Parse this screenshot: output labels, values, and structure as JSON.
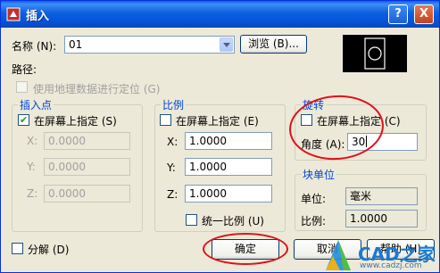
{
  "window": {
    "title": "插入",
    "help_glyph": "?",
    "close_glyph": "X"
  },
  "name_row": {
    "label": "名称 (N):",
    "value": "01",
    "browse_label": "浏览 (B)..."
  },
  "path": {
    "label": "路径:",
    "geo_checkbox_label": "使用地理数据进行定位 (G)"
  },
  "insert_point": {
    "title": "插入点",
    "on_screen_label": "在屏幕上指定 (S)",
    "on_screen_checked": true,
    "x_label": "X:",
    "y_label": "Y:",
    "z_label": "Z:",
    "x": "0.0000",
    "y": "0.0000",
    "z": "0.0000"
  },
  "scale": {
    "title": "比例",
    "on_screen_label": "在屏幕上指定 (E)",
    "on_screen_checked": false,
    "x_label": "X:",
    "y_label": "Y:",
    "z_label": "Z:",
    "x": "1.0000",
    "y": "1.0000",
    "z": "1.0000",
    "uniform_label": "统一比例 (U)"
  },
  "rotation": {
    "title": "旋转",
    "on_screen_label": "在屏幕上指定 (C)",
    "angle_label": "角度 (A):",
    "angle": "30"
  },
  "block_unit": {
    "title": "块单位",
    "unit_label": "单位:",
    "unit_value": "毫米",
    "factor_label": "比例:",
    "factor_value": "1.0000"
  },
  "explode": {
    "label": "分解 (D)"
  },
  "buttons": {
    "ok": "确定",
    "cancel": "取消",
    "help": "帮助 (H)"
  },
  "watermark": {
    "brand": "CAD之家",
    "url": "www.cadzj.com"
  },
  "colors": {
    "title_bar": "#0a5fe8",
    "dialog_bg": "#ece9d8",
    "group_title": "#0046d5",
    "annotation_red": "#e0101a"
  }
}
